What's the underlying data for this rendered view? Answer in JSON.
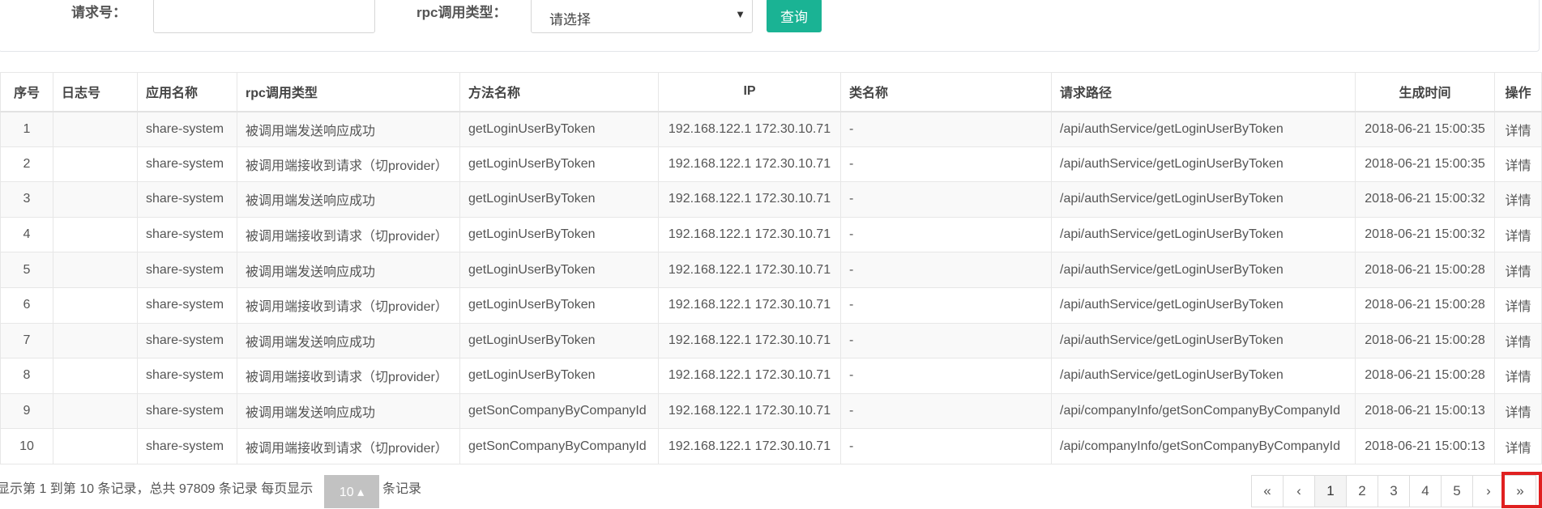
{
  "search": {
    "request_no_label": "请求号：",
    "request_no_value": "",
    "rpc_type_label": "rpc调用类型：",
    "rpc_type_selected": "请选择",
    "query_button": "查询",
    "caret_icon": "caret-down-icon"
  },
  "table": {
    "columns": [
      "序号",
      "日志号",
      "应用名称",
      "rpc调用类型",
      "方法名称",
      "IP",
      "类名称",
      "请求路径",
      "生成时间",
      "操作"
    ],
    "rows": [
      {
        "no": "1",
        "log": "",
        "app": "share-system",
        "rpc_type": "被调用端发送响应成功",
        "method": "getLoginUserByToken",
        "ip": "192.168.122.1 172.30.10.71",
        "class": "-",
        "path": "/api/authService/getLoginUserByToken",
        "time": "2018-06-21 15:00:35",
        "action": "详情"
      },
      {
        "no": "2",
        "log": "",
        "app": "share-system",
        "rpc_type": "被调用端接收到请求（切provider）",
        "method": "getLoginUserByToken",
        "ip": "192.168.122.1 172.30.10.71",
        "class": "-",
        "path": "/api/authService/getLoginUserByToken",
        "time": "2018-06-21 15:00:35",
        "action": "详情"
      },
      {
        "no": "3",
        "log": "",
        "app": "share-system",
        "rpc_type": "被调用端发送响应成功",
        "method": "getLoginUserByToken",
        "ip": "192.168.122.1 172.30.10.71",
        "class": "-",
        "path": "/api/authService/getLoginUserByToken",
        "time": "2018-06-21 15:00:32",
        "action": "详情"
      },
      {
        "no": "4",
        "log": "",
        "app": "share-system",
        "rpc_type": "被调用端接收到请求（切provider）",
        "method": "getLoginUserByToken",
        "ip": "192.168.122.1 172.30.10.71",
        "class": "-",
        "path": "/api/authService/getLoginUserByToken",
        "time": "2018-06-21 15:00:32",
        "action": "详情"
      },
      {
        "no": "5",
        "log": "",
        "app": "share-system",
        "rpc_type": "被调用端发送响应成功",
        "method": "getLoginUserByToken",
        "ip": "192.168.122.1 172.30.10.71",
        "class": "-",
        "path": "/api/authService/getLoginUserByToken",
        "time": "2018-06-21 15:00:28",
        "action": "详情"
      },
      {
        "no": "6",
        "log": "",
        "app": "share-system",
        "rpc_type": "被调用端接收到请求（切provider）",
        "method": "getLoginUserByToken",
        "ip": "192.168.122.1 172.30.10.71",
        "class": "-",
        "path": "/api/authService/getLoginUserByToken",
        "time": "2018-06-21 15:00:28",
        "action": "详情"
      },
      {
        "no": "7",
        "log": "",
        "app": "share-system",
        "rpc_type": "被调用端发送响应成功",
        "method": "getLoginUserByToken",
        "ip": "192.168.122.1 172.30.10.71",
        "class": "-",
        "path": "/api/authService/getLoginUserByToken",
        "time": "2018-06-21 15:00:28",
        "action": "详情"
      },
      {
        "no": "8",
        "log": "",
        "app": "share-system",
        "rpc_type": "被调用端接收到请求（切provider）",
        "method": "getLoginUserByToken",
        "ip": "192.168.122.1 172.30.10.71",
        "class": "-",
        "path": "/api/authService/getLoginUserByToken",
        "time": "2018-06-21 15:00:28",
        "action": "详情"
      },
      {
        "no": "9",
        "log": "",
        "app": "share-system",
        "rpc_type": "被调用端发送响应成功",
        "method": "getSonCompanyByCompanyId",
        "ip": "192.168.122.1 172.30.10.71",
        "class": "-",
        "path": "/api/companyInfo/getSonCompanyByCompanyId",
        "time": "2018-06-21 15:00:13",
        "action": "详情"
      },
      {
        "no": "10",
        "log": "",
        "app": "share-system",
        "rpc_type": "被调用端接收到请求（切provider）",
        "method": "getSonCompanyByCompanyId",
        "ip": "192.168.122.1 172.30.10.71",
        "class": "-",
        "path": "/api/companyInfo/getSonCompanyByCompanyId",
        "time": "2018-06-21 15:00:13",
        "action": "详情"
      }
    ]
  },
  "footer": {
    "summary": "显示第 1 到第 10 条记录，总共 97809 条记录 每页显示",
    "page_size": "10 ▴",
    "suffix": "条记录"
  },
  "pagination": {
    "first": "«",
    "prev": "‹",
    "pages": [
      "1",
      "2",
      "3",
      "4",
      "5"
    ],
    "active_page": "1",
    "next": "›",
    "last": "»"
  },
  "colors": {
    "accent": "#1ab394",
    "link": "#337ab7",
    "highlight": "#e02020"
  }
}
